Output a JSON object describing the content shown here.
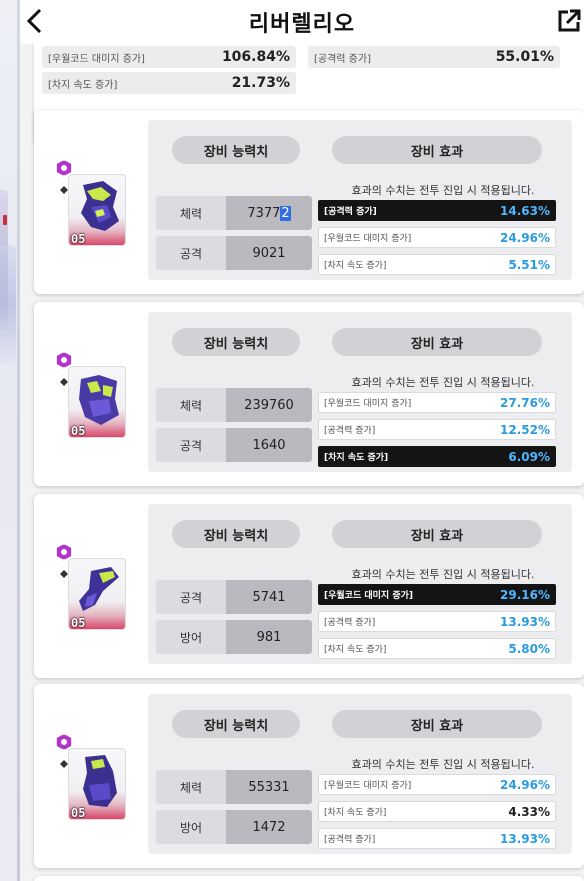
{
  "header": {
    "title": "리버렐리오"
  },
  "top_card": {
    "rows": [
      {
        "label": "[우월코드 대미지 증가]",
        "value": "106.84%"
      },
      {
        "label": "[공격력 증가]",
        "value": "55.01%"
      },
      {
        "label": "[차지 속도 증가]",
        "value": "21.73%"
      }
    ]
  },
  "common": {
    "stat_title": "장비 능력치",
    "effect_title": "장비 효과",
    "note": "효과의 수치는 전투 진입 시 적용됩니다."
  },
  "items": [
    {
      "level": "05",
      "stats": [
        {
          "name": "체력",
          "value": "7377",
          "value_cursor": "2"
        },
        {
          "name": "공격",
          "value": "9021"
        }
      ],
      "effects": [
        {
          "label": "[공격력 증가]",
          "value": "14.63%",
          "highlight": true
        },
        {
          "label": "[우월코드 대미지 증가]",
          "value": "24.96%"
        },
        {
          "label": "[차지 속도 증가]",
          "value": "5.51%"
        }
      ]
    },
    {
      "level": "05",
      "stats": [
        {
          "name": "체력",
          "value": "239760"
        },
        {
          "name": "공격",
          "value": "1640"
        }
      ],
      "effects": [
        {
          "label": "[우월코드 대미지 증가]",
          "value": "27.76%"
        },
        {
          "label": "[공격력 증가]",
          "value": "12.52%"
        },
        {
          "label": "[차지 속도 증가]",
          "value": "6.09%",
          "highlight": true
        }
      ]
    },
    {
      "level": "05",
      "stats": [
        {
          "name": "공격",
          "value": "5741"
        },
        {
          "name": "방어",
          "value": "981"
        }
      ],
      "effects": [
        {
          "label": "[우월코드 대미지 증가]",
          "value": "29.16%",
          "highlight": true
        },
        {
          "label": "[공격력 증가]",
          "value": "13.93%"
        },
        {
          "label": "[차지 속도 증가]",
          "value": "5.80%"
        }
      ]
    },
    {
      "level": "05",
      "stats": [
        {
          "name": "체력",
          "value": "55331"
        },
        {
          "name": "방어",
          "value": "1472"
        }
      ],
      "effects": [
        {
          "label": "[우월코드 대미지 증가]",
          "value": "24.96%"
        },
        {
          "label": "[차지 속도 증가]",
          "value": "4.33%",
          "plain": true
        },
        {
          "label": "[공격력 증가]",
          "value": "13.93%"
        }
      ]
    }
  ],
  "icons": {
    "back": "chevron-left-icon",
    "share": "share-external-icon"
  },
  "colors": {
    "accent": "#2b9be0",
    "highlight_bg": "#141414",
    "rarity": "#b334c9"
  }
}
